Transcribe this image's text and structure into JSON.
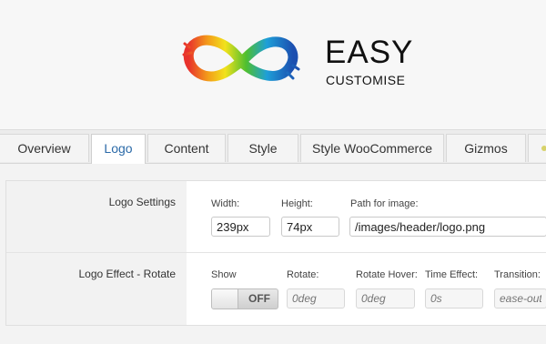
{
  "branding": {
    "title": "EASY",
    "subtitle": "CUSTOMISE"
  },
  "tabs": [
    {
      "label": "Overview"
    },
    {
      "label": "Logo",
      "active": true
    },
    {
      "label": "Content"
    },
    {
      "label": "Style"
    },
    {
      "label": "Style WooCommerce"
    },
    {
      "label": "Gizmos"
    }
  ],
  "logo_settings": {
    "label": "Logo Settings",
    "width": {
      "label": "Width:",
      "value": "239px"
    },
    "height": {
      "label": "Height:",
      "value": "74px"
    },
    "path": {
      "label": "Path for image:",
      "value": "/images/header/logo.png"
    }
  },
  "logo_effect": {
    "label": "Logo Effect - Rotate",
    "show": {
      "label": "Show",
      "state": "OFF"
    },
    "rotate": {
      "label": "Rotate:",
      "placeholder": "0deg"
    },
    "rotate_hover": {
      "label": "Rotate Hover:",
      "placeholder": "0deg"
    },
    "time_effect": {
      "label": "Time Effect:",
      "placeholder": "0s"
    },
    "transition": {
      "label": "Transition:",
      "placeholder": "ease-out"
    }
  },
  "colors": {
    "active_tab_text": "#2b6aa8",
    "extra_tab_dot": "#d7d26a"
  }
}
